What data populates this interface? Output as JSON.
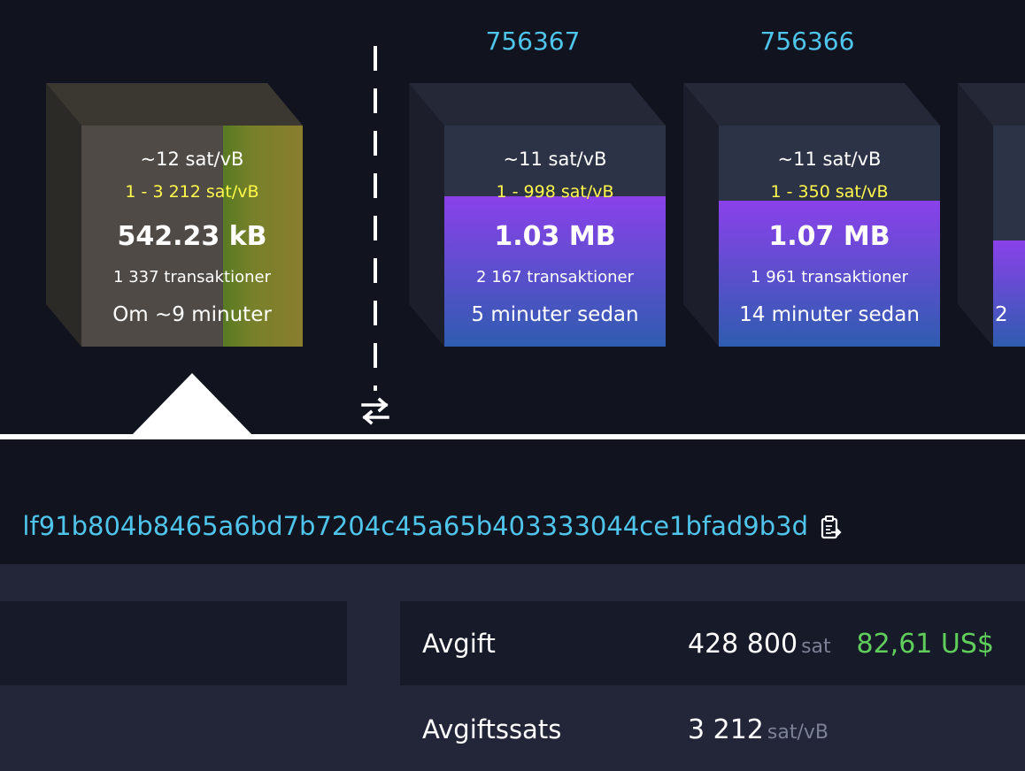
{
  "mempool_block": {
    "median_fee": "~12 sat/vB",
    "fee_range": "1 - 3 212 sat/vB",
    "size": "542.23 kB",
    "tx_count": "1 337 transaktioner",
    "eta": "Om ~9 minuter"
  },
  "blocks": [
    {
      "height": "756367",
      "median_fee": "~11 sat/vB",
      "fee_range": "1 - 998 sat/vB",
      "size": "1.03 MB",
      "tx_count": "2 167 transaktioner",
      "time_ago": "5 minuter sedan",
      "fullness": 0.68
    },
    {
      "height": "756366",
      "median_fee": "~11 sat/vB",
      "fee_range": "1 - 350 sat/vB",
      "size": "1.07 MB",
      "tx_count": "1 961 transaktioner",
      "time_ago": "14 minuter sedan",
      "fullness": 0.66
    },
    {
      "time_ago_partial": "2",
      "fullness": 0.48
    }
  ],
  "txid": "lf91b804b8465a6bd7b7204c45a65b403333044ce1bfad9b3d",
  "details": {
    "fee_label": "Avgift",
    "fee_value": "428 800",
    "fee_unit": "sat",
    "fee_fiat": "82,61 US$",
    "rate_label": "Avgiftssats",
    "rate_value": "3 212",
    "rate_unit": "sat/vB"
  },
  "icons": {
    "swap": "swap-arrows-icon",
    "copy": "clipboard-copy-icon"
  },
  "colors": {
    "background": "#11131f",
    "link": "#4fc5ec",
    "fee_range": "#fffa4a",
    "fiat": "#5fce5a",
    "block_fill_top": "#8a41ea",
    "block_fill_bottom": "#2f5cb0"
  }
}
